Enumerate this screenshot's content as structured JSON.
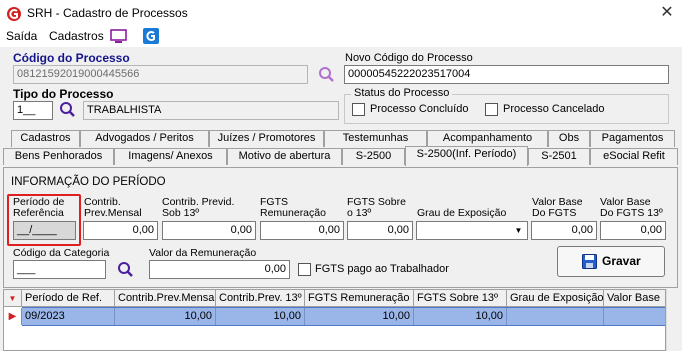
{
  "window": {
    "title": "SRH - Cadastro de Processos",
    "close_glyph": "✕"
  },
  "menu": {
    "items": [
      "Saída",
      "Cadastros"
    ]
  },
  "processo": {
    "codigo_label": "Código do Processo",
    "codigo_value": "08121592019000445566",
    "novo_codigo_label": "Novo Código do Processo",
    "novo_codigo_value": "00000545222023517004",
    "tipo_label": "Tipo do Processo",
    "tipo_code": "1__",
    "tipo_desc": "TRABALHISTA"
  },
  "status": {
    "title": "Status do Processo",
    "concluido_label": "Processo Concluído",
    "cancelado_label": "Processo Cancelado"
  },
  "tabs_row1": [
    "Cadastros",
    "Advogados / Peritos",
    "Juízes / Promotores",
    "Testemunhas",
    "Acompanhamento",
    "Obs",
    "Pagamentos"
  ],
  "tabs_row2": [
    "Bens Penhorados",
    "Imagens/ Anexos",
    "Motivo de abertura",
    "S-2500",
    "S-2500(Inf. Período)",
    "S-2501",
    "eSocial Refit"
  ],
  "periodo": {
    "section_title": "INFORMAÇÃO DO PERÍODO",
    "ref_label_1": "Período de",
    "ref_label_2": "Referência",
    "ref_value": "__/____",
    "contrib_mensal_1": "Contrib.",
    "contrib_mensal_2": "Prev.Mensal",
    "contrib_mensal_value": "0,00",
    "contrib_13_1": "Contrib. Previd.",
    "contrib_13_2": "Sob 13º",
    "contrib_13_value": "0,00",
    "fgts_rem_1": "FGTS",
    "fgts_rem_2": "Remuneração",
    "fgts_rem_value": "0,00",
    "fgts_13_1": "FGTS Sobre",
    "fgts_13_2": "o 13º",
    "fgts_13_value": "0,00",
    "grau_label": "Grau de Exposição",
    "grau_value": "",
    "vb_fgts_1": "Valor Base",
    "vb_fgts_2": "Do FGTS",
    "vb_fgts_value": "0,00",
    "vb_fgts13_1": "Valor Base",
    "vb_fgts13_2": "Do FGTS 13º",
    "vb_fgts13_value": "0,00",
    "categoria_label": "Código da Categoria",
    "categoria_value": "___",
    "valor_rem_label": "Valor da Remuneração",
    "valor_rem_value": "0,00",
    "fgts_pago_label": "FGTS pago ao Trabalhador",
    "gravar_label": "Gravar"
  },
  "grid": {
    "headers": [
      "Período de Ref.",
      "Contrib.Prev.Mensal",
      "Contrib.Prev. 13º",
      "FGTS Remuneração",
      "FGTS Sobre 13º",
      "Grau de Exposição",
      "Valor Base"
    ],
    "row": [
      "09/2023",
      "10,00",
      "10,00",
      "10,00",
      "10,00",
      "",
      ""
    ]
  },
  "colors": {
    "accent_blue": "#14148c",
    "highlight_red": "#e02020",
    "selected_row": "#9ab6e8"
  }
}
